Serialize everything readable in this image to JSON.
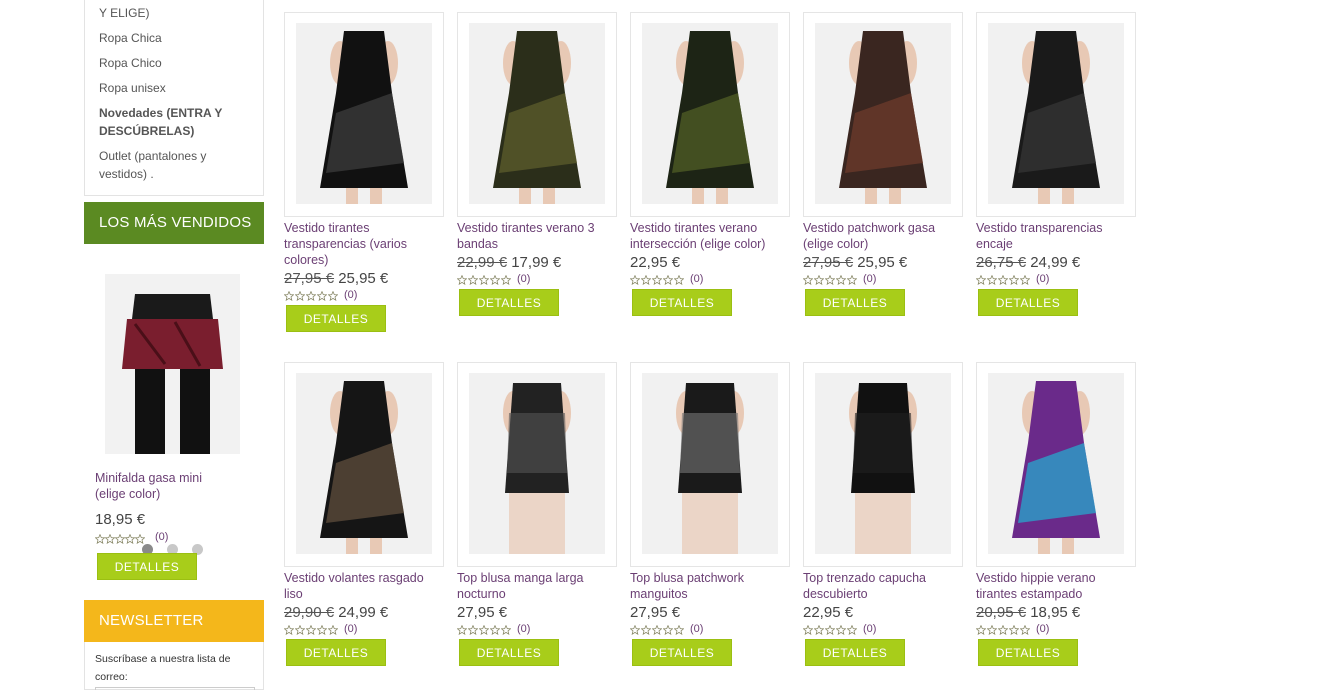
{
  "categories": [
    {
      "label": "Y ELIGE)",
      "bold": false
    },
    {
      "label": "Ropa Chica",
      "bold": false
    },
    {
      "label": "Ropa Chico",
      "bold": false
    },
    {
      "label": "Ropa unisex",
      "bold": false
    },
    {
      "label": "Novedades (ENTRA Y DESCÚBRELAS)",
      "bold": true
    },
    {
      "label": "Outlet (pantalones y vestidos) .",
      "bold": false
    }
  ],
  "bestsellers": {
    "title": "LOS MÁS VENDIDOS",
    "item": {
      "name": "Minifalda gasa mini (elige color)",
      "price": "18,95 €",
      "reviews": "(0)",
      "button": "DETALLES"
    }
  },
  "newsletter": {
    "title": "NEWSLETTER",
    "label": "Suscríbase a nuestra lista de correo:"
  },
  "products": [
    {
      "name": "Vestido tirantes transparencias (varios colores)",
      "old_price": "27,95 €",
      "price": "25,95 €",
      "reviews": "(0)",
      "button": "DETALLES"
    },
    {
      "name": "Vestido tirantes verano 3 bandas",
      "old_price": "22,99 €",
      "price": "17,99 €",
      "reviews": "(0)",
      "button": "DETALLES"
    },
    {
      "name": "Vestido tirantes verano intersección (elige color)",
      "old_price": "",
      "price": "22,95 €",
      "reviews": "(0)",
      "button": "DETALLES"
    },
    {
      "name": "Vestido patchwork gasa (elige color)",
      "old_price": "27,95 €",
      "price": "25,95 €",
      "reviews": "(0)",
      "button": "DETALLES"
    },
    {
      "name": "Vestido transparencias encaje",
      "old_price": "26,75 €",
      "price": "24,99 €",
      "reviews": "(0)",
      "button": "DETALLES"
    },
    {
      "name": "Vestido volantes rasgado liso",
      "old_price": "29,90 €",
      "price": "24,99 €",
      "reviews": "(0)",
      "button": "DETALLES"
    },
    {
      "name": "Top blusa manga larga nocturno",
      "old_price": "",
      "price": "27,95 €",
      "reviews": "(0)",
      "button": "DETALLES"
    },
    {
      "name": "Top blusa patchwork manguitos",
      "old_price": "",
      "price": "27,95 €",
      "reviews": "(0)",
      "button": "DETALLES"
    },
    {
      "name": "Top trenzado capucha descubierto",
      "old_price": "",
      "price": "22,95 €",
      "reviews": "(0)",
      "button": "DETALLES"
    },
    {
      "name": "Vestido hippie verano tirantes estampado",
      "old_price": "20,95 €",
      "price": "18,95 €",
      "reviews": "(0)",
      "button": "DETALLES"
    }
  ],
  "colors": {
    "accent_green": "#a8cd1a",
    "bestsellers_bar": "#5b8a22",
    "newsletter_bar": "#f4b71b",
    "product_link": "#6b3f74"
  }
}
